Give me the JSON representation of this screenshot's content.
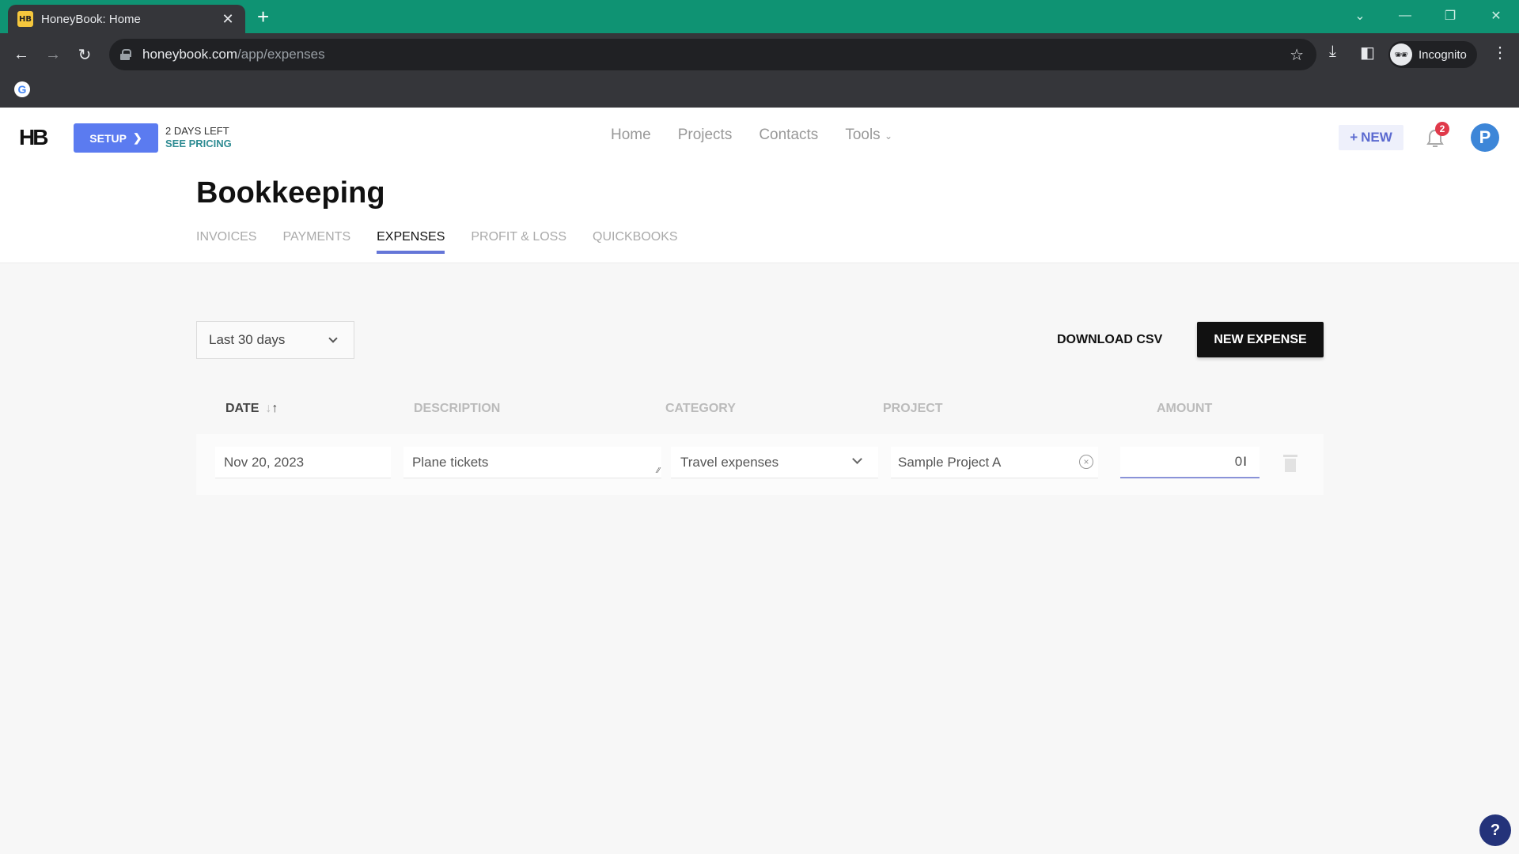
{
  "browser": {
    "tab_title": "HoneyBook: Home",
    "tab_favicon": "HB",
    "url_host": "honeybook.com",
    "url_path": "/app/expenses",
    "profile_label": "Incognito"
  },
  "header": {
    "logo": "HB",
    "setup_label": "SETUP",
    "trial_days": "2 DAYS LEFT",
    "see_pricing": "SEE PRICING",
    "nav": [
      "Home",
      "Projects",
      "Contacts",
      "Tools"
    ],
    "new_label": "NEW",
    "notification_count": "2",
    "avatar_initial": "P"
  },
  "page": {
    "title": "Bookkeeping",
    "tabs": [
      {
        "label": "INVOICES",
        "active": false
      },
      {
        "label": "PAYMENTS",
        "active": false
      },
      {
        "label": "EXPENSES",
        "active": true
      },
      {
        "label": "PROFIT & LOSS",
        "active": false
      },
      {
        "label": "QUICKBOOKS",
        "active": false
      }
    ]
  },
  "filters": {
    "range": "Last 30 days"
  },
  "actions": {
    "download_csv": "DOWNLOAD CSV",
    "new_expense": "NEW EXPENSE"
  },
  "table": {
    "columns": [
      "DATE",
      "DESCRIPTION",
      "CATEGORY",
      "PROJECT",
      "AMOUNT"
    ],
    "rows": [
      {
        "date": "Nov 20, 2023",
        "description": "Plane tickets",
        "category": "Travel expenses",
        "project": "Sample Project A",
        "amount": "0"
      }
    ]
  },
  "help_label": "?"
}
